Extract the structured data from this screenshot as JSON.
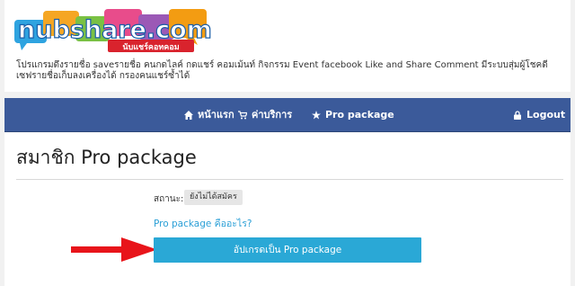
{
  "header": {
    "logo_text": "nubshare.com",
    "logo_subtext": "นับแชร์คอทคอม",
    "tagline": "โปรแกรมดึงรายชื่อ saveรายชื่อ คนกดไลค์ กดแชร์ คอมเม้นท์ กิจกรรม Event facebook Like and Share Comment มีระบบสุ่มผู้โชคดี เซฟรายชื่อเก็บลงเครื่องได้ กรองคนแชร์ซ้ำได้"
  },
  "nav": {
    "home_label": "หน้าแรก",
    "services_label": "ค่าบริการ",
    "pro_label": "Pro package",
    "logout_label": "Logout"
  },
  "main": {
    "title": "สมาชิก Pro package",
    "status_label": "สถานะ:",
    "status_value": "ยังไม่ได้สมัคร",
    "pro_link": "Pro package คืออะไร?",
    "upgrade_button": "อัปเกรดเป็น Pro package"
  },
  "colors": {
    "navbar": "#3b5a9a",
    "button": "#2aa8d6",
    "link": "#2a9fd6",
    "arrow": "#e8141a"
  },
  "icons": {
    "home": "home-icon",
    "services": "cart-icon",
    "pro": "star-icon",
    "logout": "lock-icon"
  }
}
